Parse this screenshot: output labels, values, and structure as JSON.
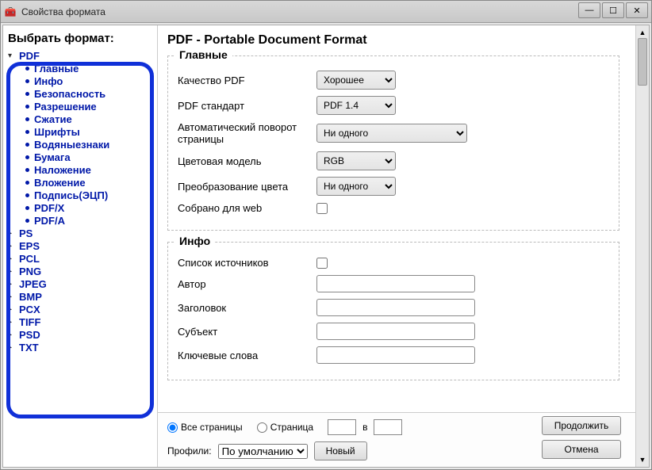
{
  "window": {
    "title": "Свойства формата"
  },
  "sidebar": {
    "heading": "Выбрать формат:",
    "formats": [
      {
        "name": "PDF",
        "expanded": true,
        "sub": [
          "Главные",
          "Инфо",
          "Безопасность",
          "Разрешение",
          "Сжатие",
          "Шрифты",
          "Водяныезнаки",
          "Бумага",
          "Наложение",
          "Вложение",
          "Подпись(ЭЦП)",
          "PDF/X",
          "PDF/A"
        ]
      },
      {
        "name": "PS"
      },
      {
        "name": "EPS"
      },
      {
        "name": "PCL"
      },
      {
        "name": "PNG"
      },
      {
        "name": "JPEG"
      },
      {
        "name": "BMP"
      },
      {
        "name": "PCX"
      },
      {
        "name": "TIFF"
      },
      {
        "name": "PSD"
      },
      {
        "name": "TXT"
      }
    ]
  },
  "main": {
    "title": "PDF - Portable Document Format",
    "group_main": {
      "legend": "Главные",
      "quality_label": "Качество PDF",
      "quality_value": "Хорошее",
      "standard_label": "PDF стандарт",
      "standard_value": "PDF 1.4",
      "autorotate_label": "Автоматический поворот страницы",
      "autorotate_value": "Ни одного",
      "colormodel_label": "Цветовая модель",
      "colormodel_value": "RGB",
      "colorconv_label": "Преобразование цвета",
      "colorconv_value": "Ни одного",
      "web_label": "Собрано для web"
    },
    "group_info": {
      "legend": "Инфо",
      "sourcelist_label": "Список источников",
      "author_label": "Автор",
      "title_label": "Заголовок",
      "subject_label": "Субъект",
      "keywords_label": "Ключевые слова"
    }
  },
  "bottom": {
    "allpages_label": "Все страницы",
    "page_label": "Страница",
    "in_label": "в",
    "profiles_label": "Профили:",
    "profile_value": "По умолчанию",
    "new_label": "Новый",
    "continue_label": "Продолжить",
    "cancel_label": "Отмена"
  }
}
